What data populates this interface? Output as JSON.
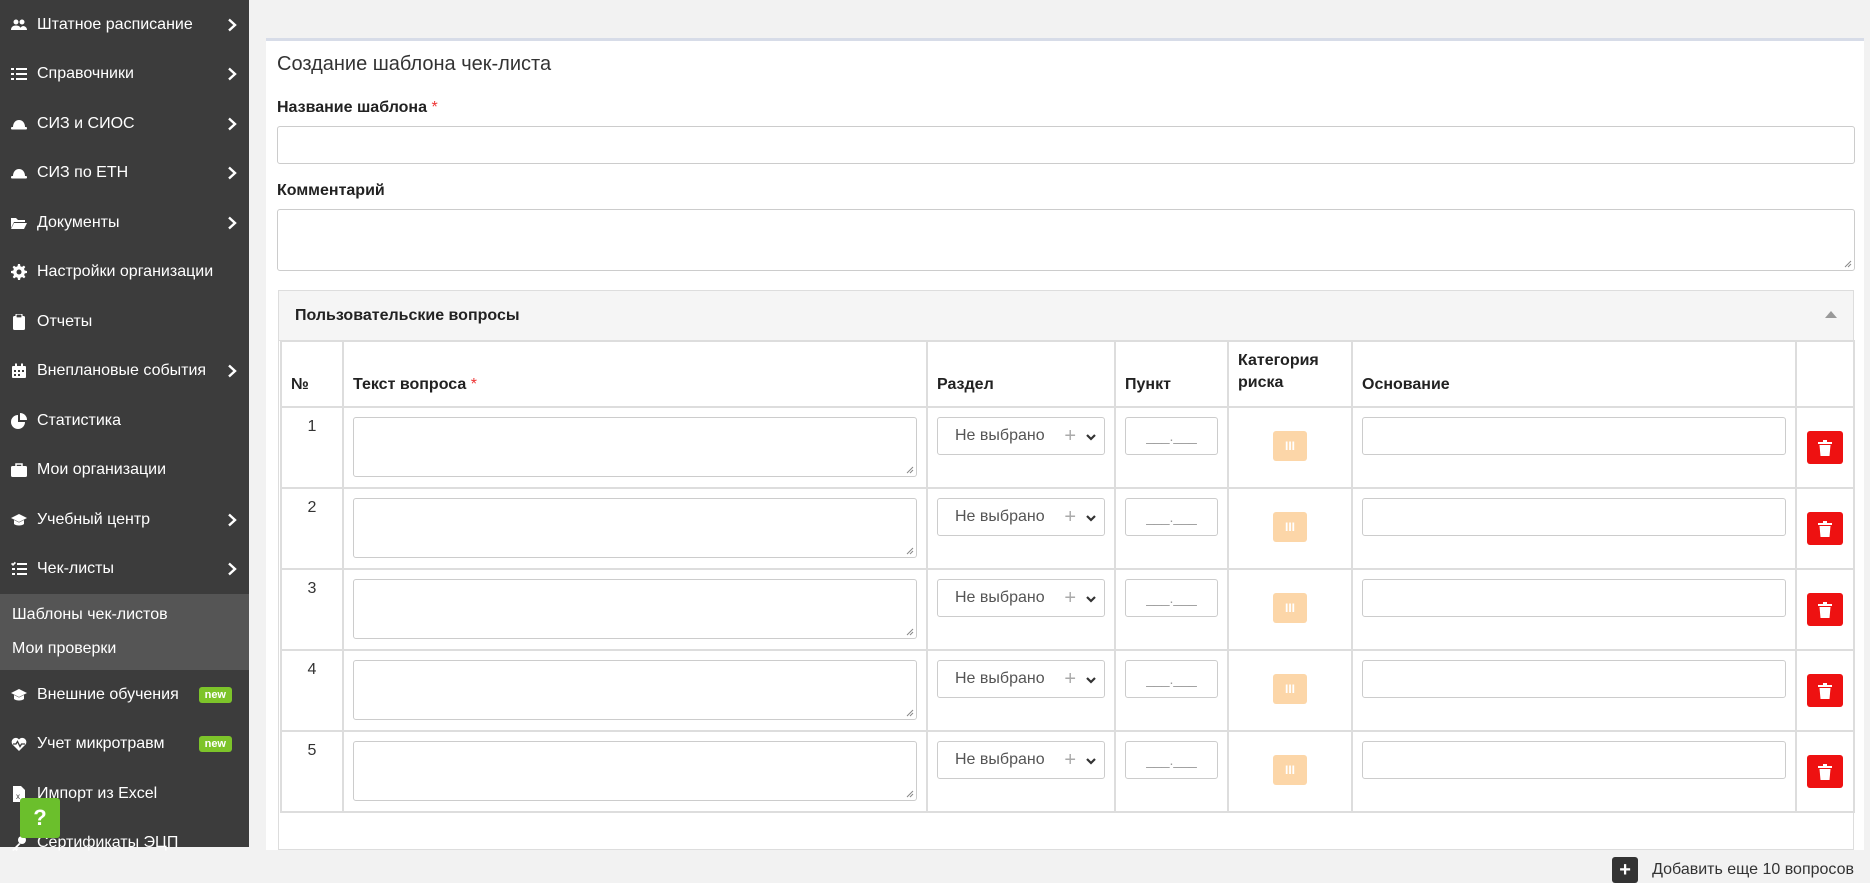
{
  "sidebar": {
    "items": [
      {
        "label": "Штатное расписание",
        "icon": "users-icon",
        "has_arrow": true
      },
      {
        "label": "Справочники",
        "icon": "list-icon",
        "has_arrow": true
      },
      {
        "label": "СИЗ и СИОС",
        "icon": "hard-hat-icon",
        "has_arrow": true
      },
      {
        "label": "СИЗ по ЕТН",
        "icon": "hard-hat-icon",
        "has_arrow": true
      },
      {
        "label": "Документы",
        "icon": "folder-open-icon",
        "has_arrow": true
      },
      {
        "label": "Настройки организации",
        "icon": "gear-icon",
        "has_arrow": false
      },
      {
        "label": "Отчеты",
        "icon": "clipboard-icon",
        "has_arrow": false
      },
      {
        "label": "Внеплановые события",
        "icon": "calendar-icon",
        "has_arrow": true
      },
      {
        "label": "Статистика",
        "icon": "pie-chart-icon",
        "has_arrow": false
      },
      {
        "label": "Мои организации",
        "icon": "briefcase-icon",
        "has_arrow": false
      },
      {
        "label": "Учебный центр",
        "icon": "graduation-cap-icon",
        "has_arrow": true
      },
      {
        "label": "Чек-листы",
        "icon": "checklist-icon",
        "has_arrow": true
      }
    ],
    "submenu": [
      "Шаблоны чек-листов",
      "Мои проверки"
    ],
    "items_after": [
      {
        "label": "Внешние обучения",
        "icon": "graduation-cap-icon",
        "badge": "new"
      },
      {
        "label": "Учет микротравм",
        "icon": "heartbeat-icon",
        "badge": "new"
      },
      {
        "label": "Импорт из Excel",
        "icon": "excel-file-icon"
      },
      {
        "label": "Сертификаты ЭЦП",
        "icon": "key-icon"
      }
    ],
    "help_label": "?"
  },
  "form": {
    "title": "Создание шаблона чек-листа",
    "name_label": "Название шаблона",
    "required_mark": "*",
    "comment_label": "Комментарий"
  },
  "questions_panel": {
    "title": "Пользовательские вопросы",
    "columns": {
      "num": "№",
      "text": "Текст вопроса",
      "section": "Раздел",
      "point": "Пункт",
      "risk": "Категория риска",
      "basis": "Основание"
    },
    "rows": [
      {
        "num": "1",
        "section": "Не выбрано",
        "point": "___.___"
      },
      {
        "num": "2",
        "section": "Не выбрано",
        "point": "___.___"
      },
      {
        "num": "3",
        "section": "Не выбрано",
        "point": "___.___"
      },
      {
        "num": "4",
        "section": "Не выбрано",
        "point": "___.___"
      },
      {
        "num": "5",
        "section": "Не выбрано",
        "point": "___.___"
      }
    ],
    "risk_marker": "III",
    "add_more_label": "Добавить еще 10 вопросов"
  },
  "colors": {
    "sidebar_bg": "#3c3c3c",
    "badge_green": "#7dc42a",
    "delete_red": "#ee1111",
    "risk_orange": "#fcd6a8"
  }
}
